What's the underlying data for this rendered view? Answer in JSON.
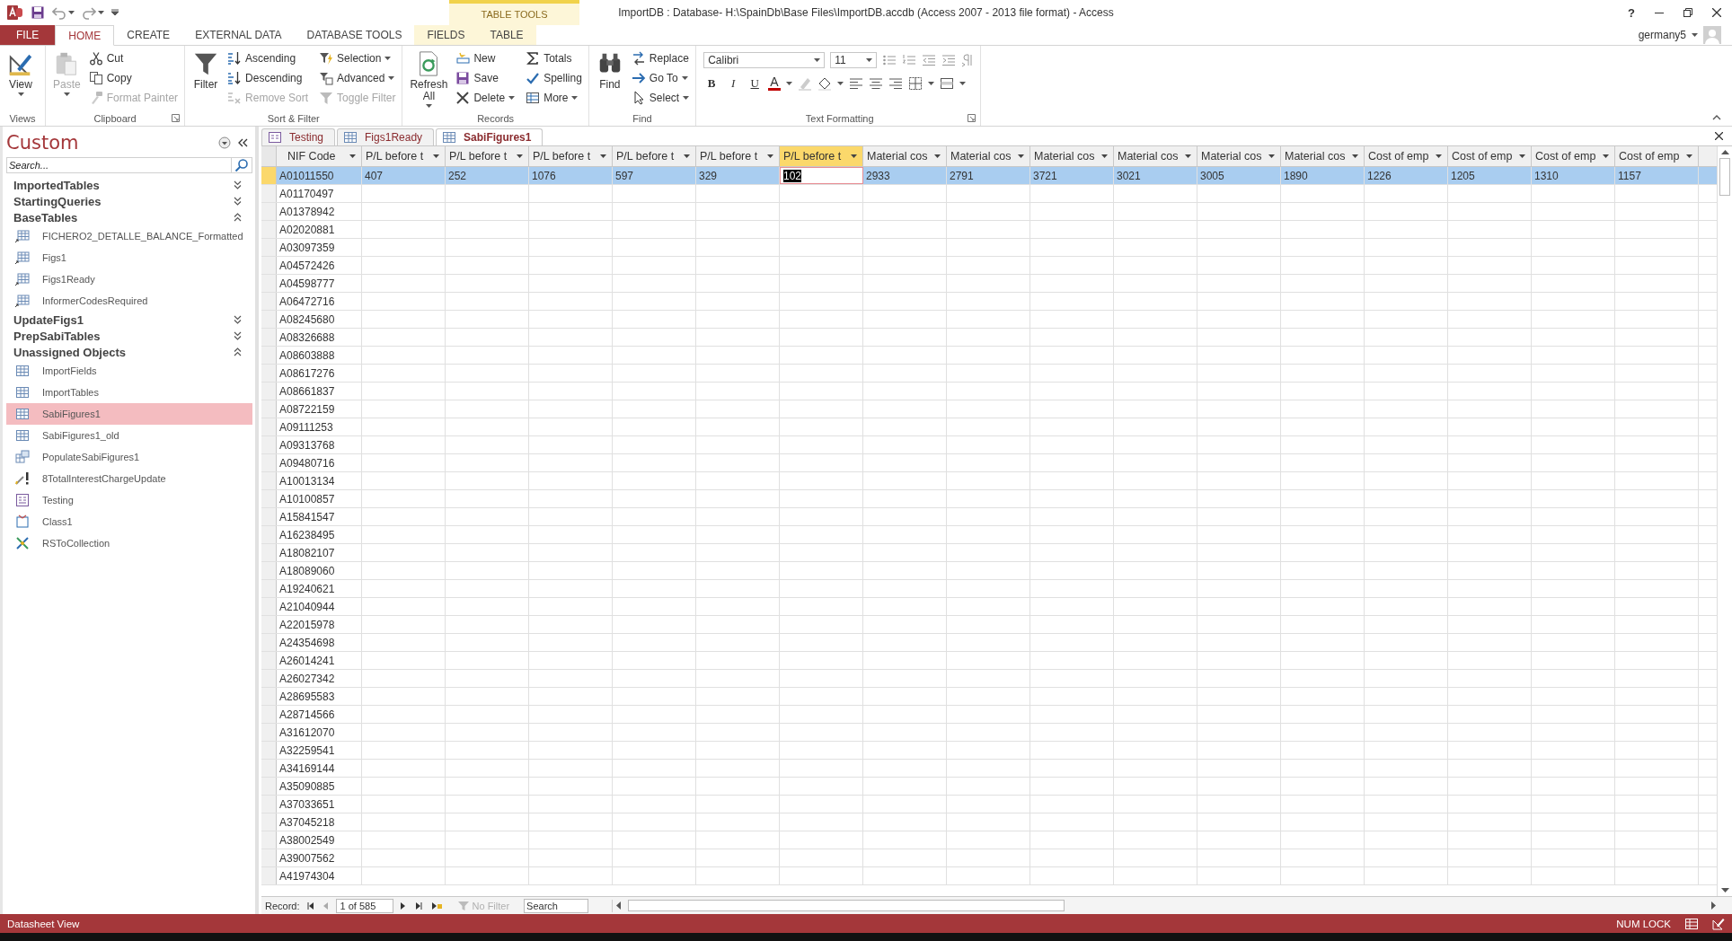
{
  "title_bar": {
    "title": "ImportDB : Database- H:\\SpainDb\\Base Files\\ImportDB.accdb (Access 2007 - 2013 file format) - Access",
    "context_group": "TABLE TOOLS",
    "help": "?",
    "user": "germany5"
  },
  "ribbon": {
    "tabs": [
      {
        "label": "FILE",
        "kind": "file",
        "selected": false
      },
      {
        "label": "HOME",
        "kind": "normal",
        "selected": true
      },
      {
        "label": "CREATE",
        "kind": "normal",
        "selected": false
      },
      {
        "label": "EXTERNAL DATA",
        "kind": "normal",
        "selected": false
      },
      {
        "label": "DATABASE TOOLS",
        "kind": "normal",
        "selected": false
      },
      {
        "label": "FIELDS",
        "kind": "context",
        "selected": false
      },
      {
        "label": "TABLE",
        "kind": "context",
        "selected": false
      }
    ],
    "groups": [
      {
        "label": "Views",
        "launcher": false,
        "commands": [
          {
            "label": "View",
            "kind": "large",
            "disabled": false,
            "menu": true
          }
        ]
      },
      {
        "label": "Clipboard",
        "launcher": true,
        "commands": [
          {
            "label": "Paste",
            "kind": "large",
            "disabled": true,
            "menu": true
          },
          {
            "label": "Cut",
            "kind": "small",
            "disabled": false,
            "menu": false
          },
          {
            "label": "Copy",
            "kind": "small",
            "disabled": false,
            "menu": false
          },
          {
            "label": "Format Painter",
            "kind": "small",
            "disabled": true,
            "menu": false
          }
        ]
      },
      {
        "label": "Sort & Filter",
        "launcher": false,
        "commands": [
          {
            "label": "Filter",
            "kind": "large",
            "disabled": false,
            "menu": false
          },
          {
            "label": "Ascending",
            "kind": "small",
            "disabled": false,
            "menu": false
          },
          {
            "label": "Descending",
            "kind": "small",
            "disabled": false,
            "menu": false
          },
          {
            "label": "Remove Sort",
            "kind": "small",
            "disabled": true,
            "menu": false
          },
          {
            "label": "Selection",
            "kind": "small",
            "disabled": false,
            "menu": true
          },
          {
            "label": "Advanced",
            "kind": "small",
            "disabled": false,
            "menu": true
          },
          {
            "label": "Toggle Filter",
            "kind": "small",
            "disabled": true,
            "menu": false
          }
        ]
      },
      {
        "label": "Records",
        "launcher": false,
        "commands": [
          {
            "label": "Refresh All",
            "kind": "large",
            "disabled": false,
            "menu": true
          },
          {
            "label": "New",
            "kind": "small",
            "disabled": false,
            "menu": false
          },
          {
            "label": "Save",
            "kind": "small",
            "disabled": false,
            "menu": false
          },
          {
            "label": "Delete",
            "kind": "small",
            "disabled": false,
            "menu": true
          },
          {
            "label": "Totals",
            "kind": "small",
            "disabled": false,
            "menu": false
          },
          {
            "label": "Spelling",
            "kind": "small",
            "disabled": false,
            "menu": false
          },
          {
            "label": "More",
            "kind": "small",
            "disabled": false,
            "menu": true
          }
        ]
      },
      {
        "label": "Find",
        "launcher": false,
        "commands": [
          {
            "label": "Find",
            "kind": "large",
            "disabled": false,
            "menu": false
          },
          {
            "label": "Replace",
            "kind": "small",
            "disabled": false,
            "menu": false
          },
          {
            "label": "Go To",
            "kind": "small",
            "disabled": false,
            "menu": true
          },
          {
            "label": "Select",
            "kind": "small",
            "disabled": false,
            "menu": true
          }
        ]
      }
    ],
    "text_formatting": {
      "label": "Text Formatting",
      "launcher": true,
      "font": "Calibri",
      "size": "11",
      "styles": [
        {
          "label": "B",
          "kind": "bold"
        },
        {
          "label": "I",
          "kind": "italic"
        },
        {
          "label": "U",
          "kind": "underline"
        }
      ],
      "font_color": "A"
    }
  },
  "navigation": {
    "title": "Custom",
    "search": {
      "placeholder": "Search..."
    },
    "groups": [
      {
        "label": "ImportedTables",
        "expanded": false
      },
      {
        "label": "StartingQueries",
        "expanded": false
      },
      {
        "label": "BaseTables",
        "expanded": true,
        "children": [
          {
            "label": "FICHERO2_DETALLE_BALANCE_Formatted",
            "kind": "linked_table",
            "selected": false
          },
          {
            "label": "Figs1",
            "kind": "linked_table",
            "selected": false
          },
          {
            "label": "Figs1Ready",
            "kind": "linked_table",
            "selected": false
          },
          {
            "label": "InformerCodesRequired",
            "kind": "linked_table",
            "selected": false
          }
        ]
      },
      {
        "label": "UpdateFigs1",
        "expanded": false
      },
      {
        "label": "PrepSabiTables",
        "expanded": false
      },
      {
        "label": "Unassigned Objects",
        "expanded": true,
        "children": [
          {
            "label": "ImportFields",
            "kind": "table",
            "selected": false
          },
          {
            "label": "ImportTables",
            "kind": "table",
            "selected": false
          },
          {
            "label": "SabiFigures1",
            "kind": "table",
            "selected": true
          },
          {
            "label": "SabiFigures1_old",
            "kind": "table",
            "selected": false
          },
          {
            "label": "PopulateSabiFigures1",
            "kind": "append_query",
            "selected": false
          },
          {
            "label": "8TotalInterestChargeUpdate",
            "kind": "update_query",
            "selected": false
          },
          {
            "label": "Testing",
            "kind": "form",
            "selected": false
          },
          {
            "label": "Class1",
            "kind": "class_module",
            "selected": false
          },
          {
            "label": "RSToCollection",
            "kind": "module",
            "selected": false
          }
        ]
      }
    ]
  },
  "document_tabs": [
    {
      "label": "Testing",
      "kind": "form",
      "selected": false
    },
    {
      "label": "Figs1Ready",
      "kind": "table",
      "selected": false
    },
    {
      "label": "SabiFigures1",
      "kind": "table",
      "selected": true
    }
  ],
  "table": {
    "columns": [
      {
        "label": "NIF Code",
        "selected": false
      },
      {
        "label": "P/L before t",
        "selected": false
      },
      {
        "label": "P/L before t",
        "selected": false
      },
      {
        "label": "P/L before t",
        "selected": false
      },
      {
        "label": "P/L before t",
        "selected": false
      },
      {
        "label": "P/L before t",
        "selected": false
      },
      {
        "label": "P/L before t",
        "selected": true
      },
      {
        "label": "Material cos",
        "selected": false
      },
      {
        "label": "Material cos",
        "selected": false
      },
      {
        "label": "Material cos",
        "selected": false
      },
      {
        "label": "Material cos",
        "selected": false
      },
      {
        "label": "Material cos",
        "selected": false
      },
      {
        "label": "Material cos",
        "selected": false
      },
      {
        "label": "Cost of emp",
        "selected": false
      },
      {
        "label": "Cost of emp",
        "selected": false
      },
      {
        "label": "Cost of emp",
        "selected": false
      },
      {
        "label": "Cost of emp",
        "selected": false
      }
    ],
    "rows": [
      {
        "cells": [
          "A01011550",
          "407",
          "252",
          "1076",
          "597",
          "329",
          "102",
          "2933",
          "2791",
          "3721",
          "3021",
          "3005",
          "1890",
          "1226",
          "1205",
          "1310",
          "1157"
        ],
        "selected": true
      },
      {
        "cells": [
          "A01170497"
        ],
        "selected": false
      },
      {
        "cells": [
          "A01378942"
        ],
        "selected": false
      },
      {
        "cells": [
          "A02020881"
        ],
        "selected": false
      },
      {
        "cells": [
          "A03097359"
        ],
        "selected": false
      },
      {
        "cells": [
          "A04572426"
        ],
        "selected": false
      },
      {
        "cells": [
          "A04598777"
        ],
        "selected": false
      },
      {
        "cells": [
          "A06472716"
        ],
        "selected": false
      },
      {
        "cells": [
          "A08245680"
        ],
        "selected": false
      },
      {
        "cells": [
          "A08326688"
        ],
        "selected": false
      },
      {
        "cells": [
          "A08603888"
        ],
        "selected": false
      },
      {
        "cells": [
          "A08617276"
        ],
        "selected": false
      },
      {
        "cells": [
          "A08661837"
        ],
        "selected": false
      },
      {
        "cells": [
          "A08722159"
        ],
        "selected": false
      },
      {
        "cells": [
          "A09111253"
        ],
        "selected": false
      },
      {
        "cells": [
          "A09313768"
        ],
        "selected": false
      },
      {
        "cells": [
          "A09480716"
        ],
        "selected": false
      },
      {
        "cells": [
          "A10013134"
        ],
        "selected": false
      },
      {
        "cells": [
          "A10100857"
        ],
        "selected": false
      },
      {
        "cells": [
          "A15841547"
        ],
        "selected": false
      },
      {
        "cells": [
          "A16238495"
        ],
        "selected": false
      },
      {
        "cells": [
          "A18082107"
        ],
        "selected": false
      },
      {
        "cells": [
          "A18089060"
        ],
        "selected": false
      },
      {
        "cells": [
          "A19240621"
        ],
        "selected": false
      },
      {
        "cells": [
          "A21040944"
        ],
        "selected": false
      },
      {
        "cells": [
          "A22015978"
        ],
        "selected": false
      },
      {
        "cells": [
          "A24354698"
        ],
        "selected": false
      },
      {
        "cells": [
          "A26014241"
        ],
        "selected": false
      },
      {
        "cells": [
          "A26027342"
        ],
        "selected": false
      },
      {
        "cells": [
          "A28695583"
        ],
        "selected": false
      },
      {
        "cells": [
          "A28714566"
        ],
        "selected": false
      },
      {
        "cells": [
          "A31612070"
        ],
        "selected": false
      },
      {
        "cells": [
          "A32259541"
        ],
        "selected": false
      },
      {
        "cells": [
          "A34169144"
        ],
        "selected": false
      },
      {
        "cells": [
          "A35090885"
        ],
        "selected": false
      },
      {
        "cells": [
          "A37033651"
        ],
        "selected": false
      },
      {
        "cells": [
          "A37045218"
        ],
        "selected": false
      },
      {
        "cells": [
          "A38002549"
        ],
        "selected": false
      },
      {
        "cells": [
          "A39007562"
        ],
        "selected": false
      },
      {
        "cells": [
          "A41974304"
        ],
        "selected": false
      }
    ]
  },
  "record_navigator": {
    "label": "Record:",
    "position": "1 of 585",
    "filter": {
      "label": "No Filter",
      "disabled": true
    },
    "search": {
      "placeholder": "Search"
    }
  },
  "status_bar": {
    "view": "Datasheet View",
    "indicator": "NUM LOCK"
  }
}
